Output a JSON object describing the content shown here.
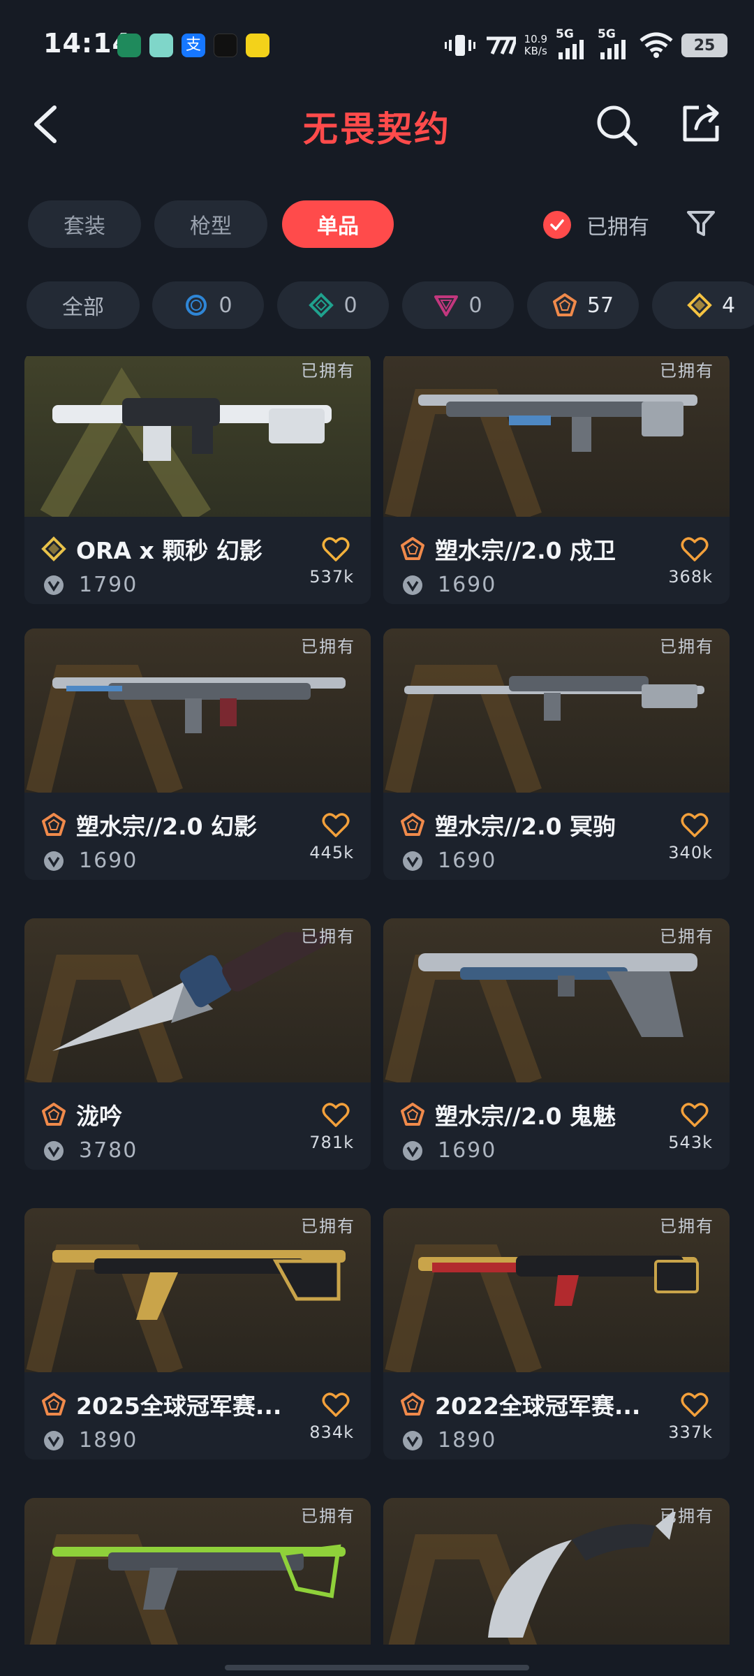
{
  "status_bar": {
    "time": "14:14",
    "network_speed_value": "10.9",
    "network_speed_unit": "KB/s",
    "sim1": "5G",
    "sim2": "5G",
    "battery": "25",
    "app_icons": [
      "app-icon-green",
      "app-icon-teal",
      "alipay-icon",
      "tiktok-icon",
      "app-icon-yellow"
    ]
  },
  "header": {
    "title": "无畏契约"
  },
  "tabs": [
    {
      "label": "套装",
      "active": false
    },
    {
      "label": "枪型",
      "active": false
    },
    {
      "label": "单品",
      "active": true
    }
  ],
  "owned_filter_label": "已拥有",
  "rarity_chips": [
    {
      "label": "全部"
    },
    {
      "count": "0",
      "icon": "select-tier-icon",
      "color": "#2f86d6"
    },
    {
      "count": "0",
      "icon": "deluxe-tier-icon",
      "color": "#1fa28e"
    },
    {
      "count": "0",
      "icon": "premium-tier-icon",
      "color": "#c2377e"
    },
    {
      "count": "57",
      "icon": "exclusive-tier-icon",
      "color": "#f08a4b"
    },
    {
      "count": "4",
      "icon": "ultra-tier-icon",
      "color": "#f5c342"
    }
  ],
  "cards": [
    {
      "owned": "已拥有",
      "name": "ORA x 颗秒 幻影",
      "price": "1790",
      "likes": "537k",
      "tier": "ultra",
      "tier_color": "#e8c24a",
      "weapon": "rifle-white"
    },
    {
      "owned": "已拥有",
      "name": "塑水宗//2.0 戍卫",
      "price": "1690",
      "likes": "368k",
      "tier": "exclusive",
      "tier_color": "#f08a4b",
      "weapon": "rifle-silver"
    },
    {
      "owned": "已拥有",
      "name": "塑水宗//2.0 幻影",
      "price": "1690",
      "likes": "445k",
      "tier": "exclusive",
      "tier_color": "#f08a4b",
      "weapon": "rifle-silver"
    },
    {
      "owned": "已拥有",
      "name": "塑水宗//2.0 冥驹",
      "price": "1690",
      "likes": "340k",
      "tier": "exclusive",
      "tier_color": "#f08a4b",
      "weapon": "sniper-silver"
    },
    {
      "owned": "已拥有",
      "name": "泷吟",
      "price": "3780",
      "likes": "781k",
      "tier": "exclusive",
      "tier_color": "#f08a4b",
      "weapon": "knife-blue"
    },
    {
      "owned": "已拥有",
      "name": "塑水宗//2.0 鬼魅",
      "price": "1690",
      "likes": "543k",
      "tier": "exclusive",
      "tier_color": "#f08a4b",
      "weapon": "pistol-silver"
    },
    {
      "owned": "已拥有",
      "name": "2025全球冠军赛...",
      "price": "1890",
      "likes": "834k",
      "tier": "exclusive",
      "tier_color": "#f08a4b",
      "weapon": "rifle-gold"
    },
    {
      "owned": "已拥有",
      "name": "2022全球冠军赛...",
      "price": "1890",
      "likes": "337k",
      "tier": "exclusive",
      "tier_color": "#f08a4b",
      "weapon": "rifle-red"
    },
    {
      "owned": "已拥有",
      "name": "",
      "price": "",
      "likes": "",
      "tier": "exclusive",
      "tier_color": "#f08a4b",
      "weapon": "rifle-green"
    },
    {
      "owned": "已拥有",
      "name": "",
      "price": "",
      "likes": "",
      "tier": "exclusive",
      "tier_color": "#f08a4b",
      "weapon": "karambit"
    }
  ]
}
